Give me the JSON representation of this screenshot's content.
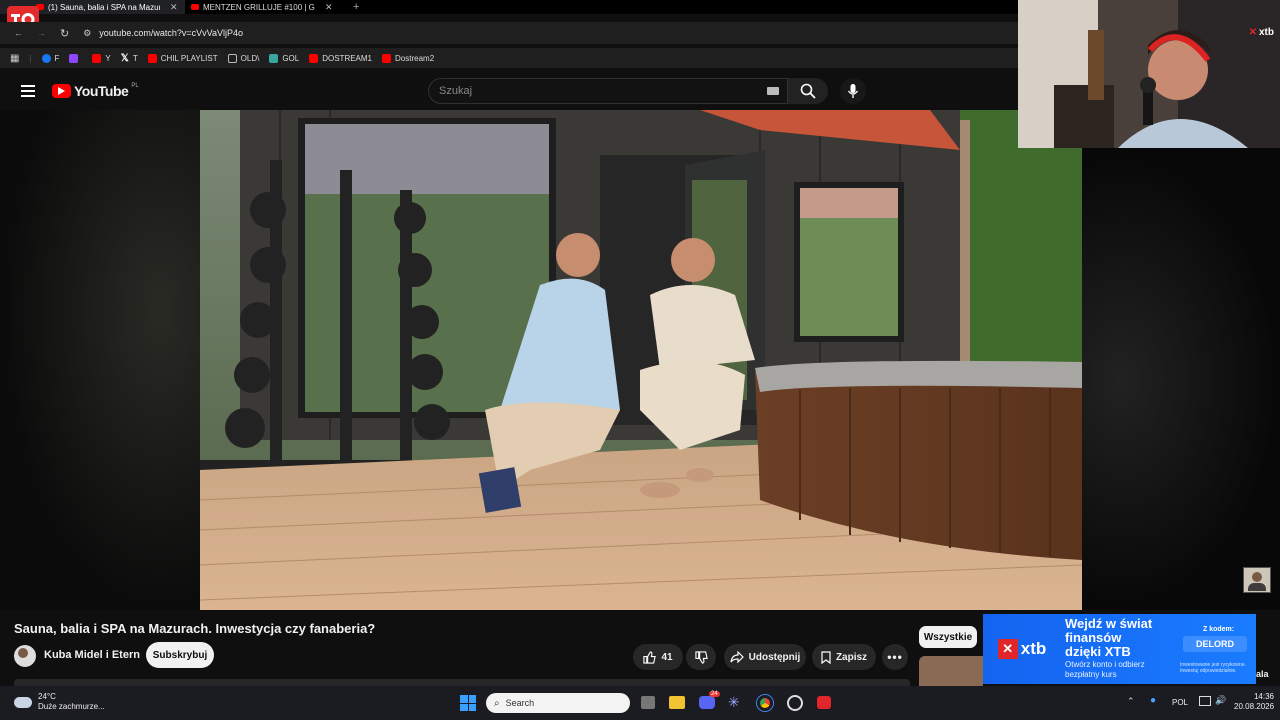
{
  "browser": {
    "tabs": [
      {
        "title": "(1) Sauna, balia i SPA na Mazurach",
        "active": true
      },
      {
        "title": "MENTZEN GRILLUJE #100 | Gol",
        "active": false
      }
    ],
    "new_tab": "+",
    "url": "youtube.com/watch?v=cVvVaVljP4o",
    "bookmarks": [
      {
        "label": "F",
        "icon": "facebook-icon",
        "color": "#1877f2"
      },
      {
        "label": "",
        "icon": "twitch-icon",
        "color": "#9146ff"
      },
      {
        "label": "Y",
        "icon": "youtube-icon",
        "color": "#ff0000"
      },
      {
        "label": "T",
        "icon": "x-icon",
        "color": "#ffffff"
      },
      {
        "label": "CHIL PLAYLIST",
        "icon": "youtube-icon",
        "color": "#ff0000"
      },
      {
        "label": "OLD\\",
        "icon": "folder-icon",
        "color": "#bbbbbb"
      },
      {
        "label": "GOL",
        "icon": "gol-icon",
        "color": "#3aa6a0"
      },
      {
        "label": "DOSTREAM1",
        "icon": "youtube-icon",
        "color": "#ff0000"
      },
      {
        "label": "Dostream2",
        "icon": "youtube-icon",
        "color": "#ff0000"
      }
    ]
  },
  "youtube": {
    "logo_text": "YouTube",
    "region": "PL",
    "search_placeholder": "Szukaj",
    "video_title": "Sauna, balia i SPA na Mazurach. Inwestycja czy fanaberia?",
    "channel_name": "Kuba Midel i Etern",
    "subscribe_label": "Subskrybuj",
    "like_count": "41",
    "share_label": "Udostępnij",
    "save_label": "Zapisz",
    "filter_chip": "Wszystkie",
    "side_partial": "ala"
  },
  "overlay": {
    "brand": "xtb"
  },
  "ad": {
    "headline_1": "Wejdź w świat",
    "headline_2": "finansów",
    "headline_3": "dzięki XTB",
    "sub_1": "Otwórz konto i odbierz",
    "sub_2": "bezpłatny kurs",
    "code_label": "Z kodem:",
    "code": "DELORD",
    "disclaimer": "Inwestowanie jest ryzykowne. Inwestuj odpowiedzialnie.",
    "logo": "xtb"
  },
  "taskbar": {
    "weather_temp": "24°C",
    "weather_desc": "Duże zachmurze...",
    "search": "Search",
    "language": "POL",
    "time": "14:36",
    "date": "20.08.2026",
    "discord_badge": "24"
  },
  "colors": {
    "yt_red": "#ff0000",
    "xtb_blue": "#1a73ff",
    "xtb_red": "#e0262b"
  }
}
